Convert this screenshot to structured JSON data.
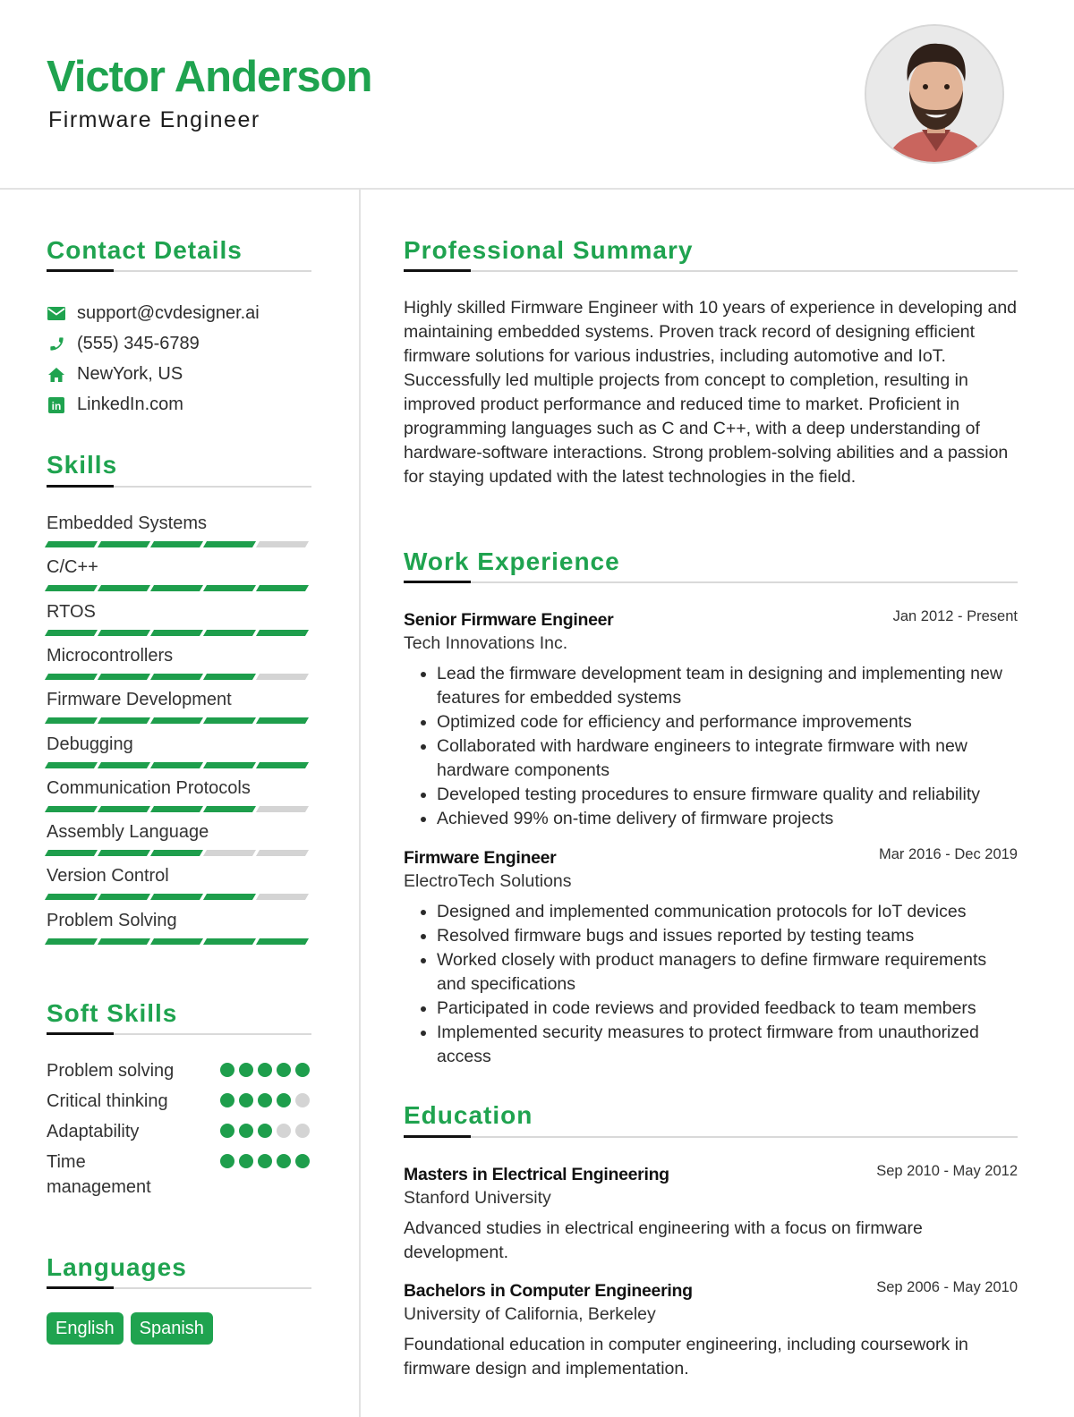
{
  "header": {
    "name": "Victor Anderson",
    "title": "Firmware Engineer",
    "photo_alt": "profile-photo"
  },
  "colors": {
    "accent": "#1fa34f",
    "inactive": "#d4d4d4",
    "rule": "#d9d9d9"
  },
  "contact": {
    "heading": "Contact Details",
    "items": [
      {
        "icon": "envelope-icon",
        "value": "support@cvdesigner.ai"
      },
      {
        "icon": "phone-icon",
        "value": "(555) 345-6789"
      },
      {
        "icon": "home-icon",
        "value": "NewYork, US"
      },
      {
        "icon": "linkedin-icon",
        "value": "LinkedIn.com"
      }
    ]
  },
  "skills": {
    "heading": "Skills",
    "max": 5,
    "items": [
      {
        "label": "Embedded Systems",
        "level": 4
      },
      {
        "label": "C/C++",
        "level": 5
      },
      {
        "label": "RTOS",
        "level": 5
      },
      {
        "label": "Microcontrollers",
        "level": 4
      },
      {
        "label": "Firmware Development",
        "level": 5
      },
      {
        "label": "Debugging",
        "level": 5
      },
      {
        "label": "Communication Protocols",
        "level": 4
      },
      {
        "label": "Assembly Language",
        "level": 3
      },
      {
        "label": "Version Control",
        "level": 4
      },
      {
        "label": "Problem Solving",
        "level": 5
      }
    ]
  },
  "soft_skills": {
    "heading": "Soft Skills",
    "max": 5,
    "items": [
      {
        "label": "Problem solving",
        "level": 5
      },
      {
        "label": "Critical thinking",
        "level": 4
      },
      {
        "label": "Adaptability",
        "level": 3
      },
      {
        "label": "Time management",
        "level": 5
      }
    ]
  },
  "languages": {
    "heading": "Languages",
    "items": [
      "English",
      "Spanish"
    ]
  },
  "summary": {
    "heading": "Professional Summary",
    "text": "Highly skilled Firmware Engineer with 10 years of experience in developing and maintaining embedded systems. Proven track record of designing efficient firmware solutions for various industries, including automotive and IoT. Successfully led multiple projects from concept to completion, resulting in improved product performance and reduced time to market. Proficient in programming languages such as C and C++, with a deep understanding of hardware-software interactions. Strong problem-solving abilities and a passion for staying updated with the latest technologies in the field."
  },
  "experience": {
    "heading": "Work Experience",
    "jobs": [
      {
        "title": "Senior Firmware Engineer",
        "company": "Tech Innovations Inc.",
        "dates": "Jan 2012 - Present",
        "bullets": [
          "Lead the firmware development team in designing and implementing new features for embedded systems",
          "Optimized code for efficiency and performance improvements",
          "Collaborated with hardware engineers to integrate firmware with new hardware components",
          "Developed testing procedures to ensure firmware quality and reliability",
          "Achieved 99% on-time delivery of firmware projects"
        ]
      },
      {
        "title": "Firmware Engineer",
        "company": "ElectroTech Solutions",
        "dates": "Mar 2016 - Dec 2019",
        "bullets": [
          "Designed and implemented communication protocols for IoT devices",
          "Resolved firmware bugs and issues reported by testing teams",
          "Worked closely with product managers to define firmware requirements and specifications",
          "Participated in code reviews and provided feedback to team members",
          "Implemented security measures to protect firmware from unauthorized access"
        ]
      }
    ]
  },
  "education": {
    "heading": "Education",
    "items": [
      {
        "degree": "Masters in Electrical Engineering",
        "school": "Stanford University",
        "dates": "Sep 2010 - May 2012",
        "description": "Advanced studies in electrical engineering with a focus on firmware development."
      },
      {
        "degree": "Bachelors in Computer Engineering",
        "school": "University of California, Berkeley",
        "dates": "Sep 2006 - May 2010",
        "description": "Foundational education in computer engineering, including coursework in firmware design and implementation."
      }
    ]
  }
}
